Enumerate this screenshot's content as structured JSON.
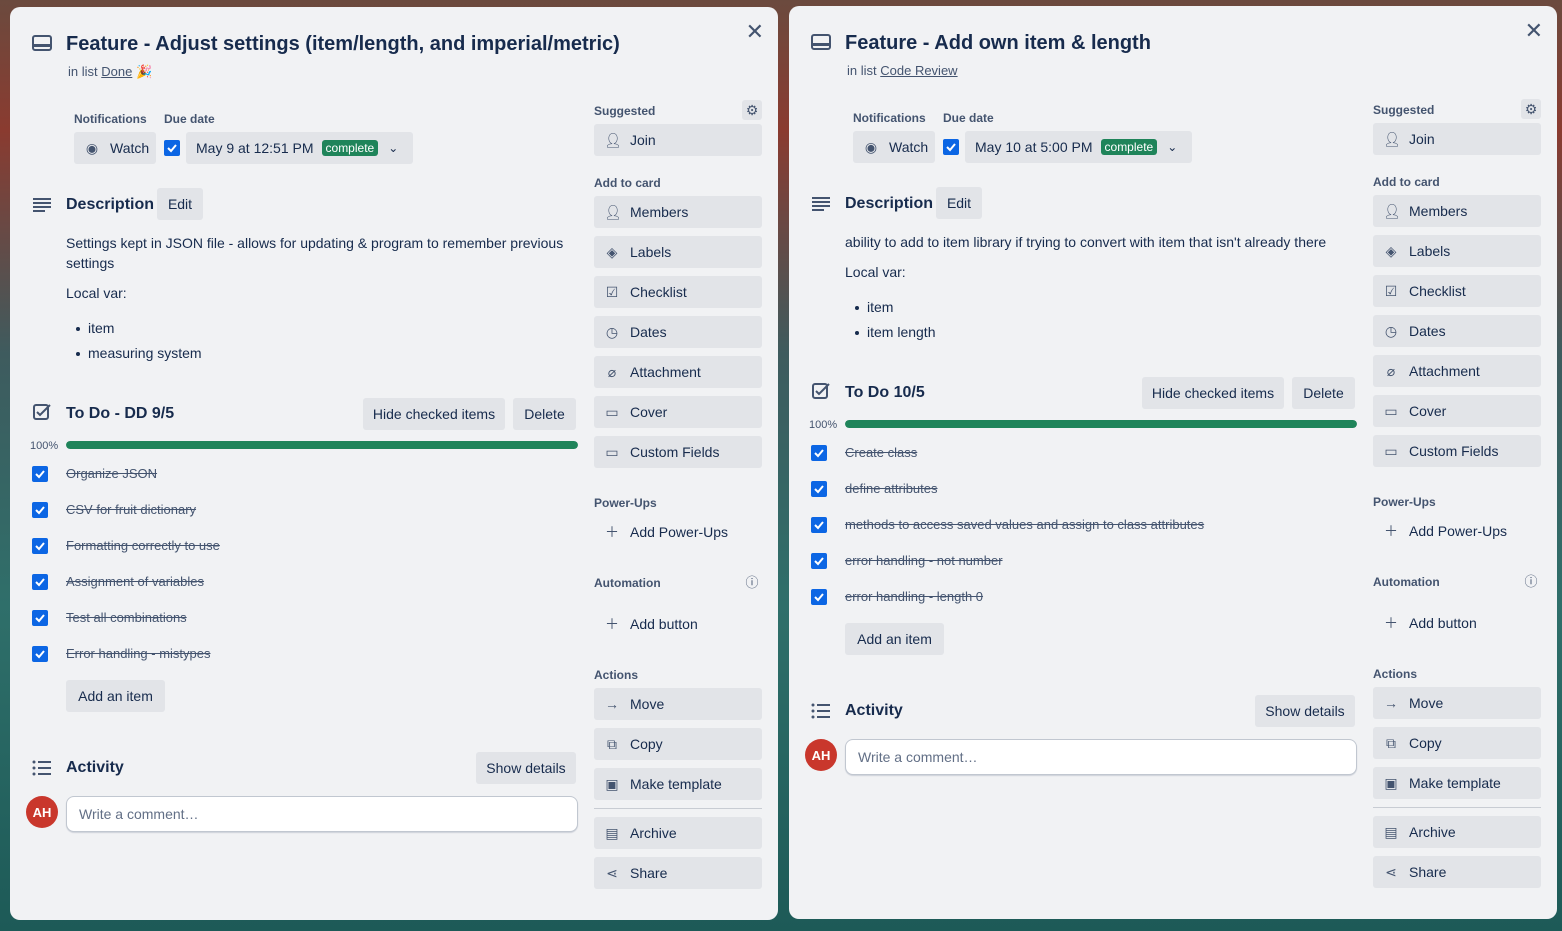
{
  "cards": [
    {
      "title": "Feature - Adjust settings (item/length, and imperial/metric)",
      "in_list_prefix": "in list",
      "list_name": "Done",
      "list_emoji": "🎉",
      "notifications_label": "Notifications",
      "due_date_label": "Due date",
      "watch_label": "Watch",
      "due_date_value": "May 9 at 12:51 PM",
      "complete_badge": "complete",
      "description_title": "Description",
      "edit_label": "Edit",
      "description_text": "Settings kept in JSON file - allows for updating & program to remember previous settings",
      "local_var_label": "Local var:",
      "local_vars": [
        "item",
        "measuring system"
      ],
      "checklist_title": "To Do - DD 9/5",
      "hide_checked_label": "Hide checked items",
      "delete_label": "Delete",
      "progress_text": "100%",
      "progress_value": 1.0,
      "checklist_items": [
        "Organize JSON",
        "CSV for fruit dictionary",
        "Formatting correctly to use",
        "Assignment of variables",
        "Test all combinations",
        "Error handling - mistypes"
      ],
      "add_item_label": "Add an item",
      "activity_title": "Activity",
      "show_details_label": "Show details",
      "avatar_initials": "AH",
      "comment_placeholder": "Write a comment…"
    },
    {
      "title": "Feature - Add own item & length",
      "in_list_prefix": "in list",
      "list_name": "Code Review",
      "list_emoji": "",
      "notifications_label": "Notifications",
      "due_date_label": "Due date",
      "watch_label": "Watch",
      "due_date_value": "May 10 at 5:00 PM",
      "complete_badge": "complete",
      "description_title": "Description",
      "edit_label": "Edit",
      "description_text": "ability to add to item library if trying to convert with item that isn't already there",
      "local_var_label": "Local var:",
      "local_vars": [
        "item",
        "item length"
      ],
      "checklist_title": "To Do 10/5",
      "hide_checked_label": "Hide checked items",
      "delete_label": "Delete",
      "progress_text": "100%",
      "progress_value": 1.0,
      "checklist_items": [
        "Create class",
        "define attributes",
        "methods to access saved values and assign to class attributes",
        "error handling - not number",
        "error handling - length 0"
      ],
      "add_item_label": "Add an item",
      "activity_title": "Activity",
      "show_details_label": "Show details",
      "avatar_initials": "AH",
      "comment_placeholder": "Write a comment…"
    }
  ],
  "sidebar": {
    "suggested_label": "Suggested",
    "join_label": "Join",
    "add_to_card_label": "Add to card",
    "add_to_card": [
      {
        "label": "Members",
        "icon": "person-icon"
      },
      {
        "label": "Labels",
        "icon": "tag-icon"
      },
      {
        "label": "Checklist",
        "icon": "checklist-icon"
      },
      {
        "label": "Dates",
        "icon": "clock-icon"
      },
      {
        "label": "Attachment",
        "icon": "paperclip-icon"
      },
      {
        "label": "Cover",
        "icon": "cover-icon"
      },
      {
        "label": "Custom Fields",
        "icon": "custom-fields-icon"
      }
    ],
    "power_ups_label": "Power-Ups",
    "add_power_ups_label": "Add Power-Ups",
    "automation_label": "Automation",
    "add_button_label": "Add button",
    "actions_label": "Actions",
    "actions": [
      {
        "label": "Move",
        "icon": "arrow-right-icon"
      },
      {
        "label": "Copy",
        "icon": "copy-icon"
      },
      {
        "label": "Make template",
        "icon": "template-icon"
      }
    ],
    "archive_label": "Archive",
    "share_label": "Share"
  },
  "colors": {
    "accent_blue": "#0c66e4",
    "complete_green": "#1f845a",
    "avatar_red": "#c9372c"
  }
}
